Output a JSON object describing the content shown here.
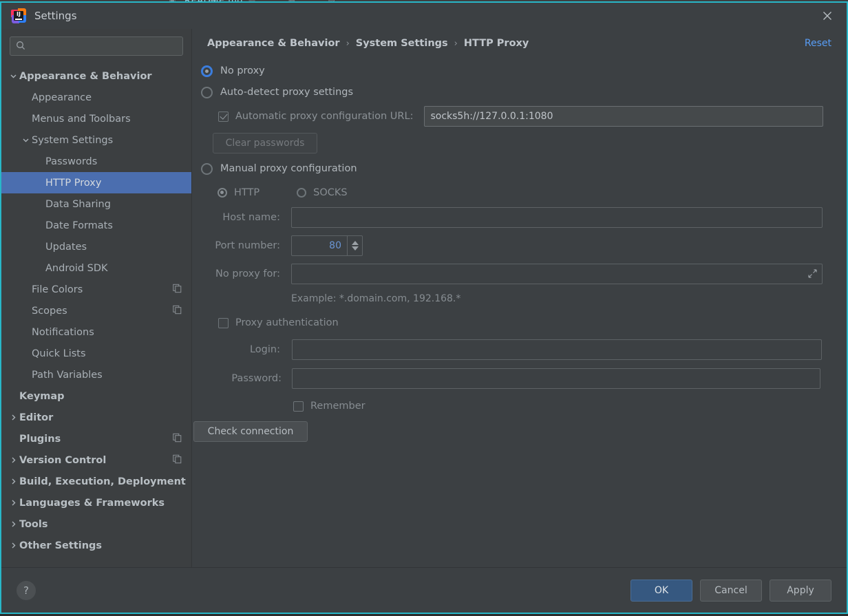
{
  "backdrop": {
    "text": "README.md",
    "icons": "▣ ▤ ▥ ▦ ▧"
  },
  "titlebar": {
    "title": "Settings",
    "logo_text": "IJ",
    "close_icon": "close-icon"
  },
  "sidebar": {
    "search": {
      "value": "",
      "placeholder": "",
      "icon": "search-icon"
    },
    "items": [
      {
        "label": "Appearance & Behavior",
        "indent": 0,
        "bold": true,
        "twisty": "down",
        "selected": false,
        "copy": false
      },
      {
        "label": "Appearance",
        "indent": 1,
        "bold": false,
        "twisty": "none",
        "selected": false,
        "copy": false
      },
      {
        "label": "Menus and Toolbars",
        "indent": 1,
        "bold": false,
        "twisty": "none",
        "selected": false,
        "copy": false
      },
      {
        "label": "System Settings",
        "indent": 1,
        "bold": false,
        "twisty": "down",
        "selected": false,
        "copy": false
      },
      {
        "label": "Passwords",
        "indent": 2,
        "bold": false,
        "twisty": "none",
        "selected": false,
        "copy": false
      },
      {
        "label": "HTTP Proxy",
        "indent": 2,
        "bold": false,
        "twisty": "none",
        "selected": true,
        "copy": false
      },
      {
        "label": "Data Sharing",
        "indent": 2,
        "bold": false,
        "twisty": "none",
        "selected": false,
        "copy": false
      },
      {
        "label": "Date Formats",
        "indent": 2,
        "bold": false,
        "twisty": "none",
        "selected": false,
        "copy": false
      },
      {
        "label": "Updates",
        "indent": 2,
        "bold": false,
        "twisty": "none",
        "selected": false,
        "copy": false
      },
      {
        "label": "Android SDK",
        "indent": 2,
        "bold": false,
        "twisty": "none",
        "selected": false,
        "copy": false
      },
      {
        "label": "File Colors",
        "indent": 1,
        "bold": false,
        "twisty": "none",
        "selected": false,
        "copy": true
      },
      {
        "label": "Scopes",
        "indent": 1,
        "bold": false,
        "twisty": "none",
        "selected": false,
        "copy": true
      },
      {
        "label": "Notifications",
        "indent": 1,
        "bold": false,
        "twisty": "none",
        "selected": false,
        "copy": false
      },
      {
        "label": "Quick Lists",
        "indent": 1,
        "bold": false,
        "twisty": "none",
        "selected": false,
        "copy": false
      },
      {
        "label": "Path Variables",
        "indent": 1,
        "bold": false,
        "twisty": "none",
        "selected": false,
        "copy": false
      },
      {
        "label": "Keymap",
        "indent": 0,
        "bold": true,
        "twisty": "none",
        "selected": false,
        "copy": false
      },
      {
        "label": "Editor",
        "indent": 0,
        "bold": true,
        "twisty": "right",
        "selected": false,
        "copy": false
      },
      {
        "label": "Plugins",
        "indent": 0,
        "bold": true,
        "twisty": "none",
        "selected": false,
        "copy": true
      },
      {
        "label": "Version Control",
        "indent": 0,
        "bold": true,
        "twisty": "right",
        "selected": false,
        "copy": true
      },
      {
        "label": "Build, Execution, Deployment",
        "indent": 0,
        "bold": true,
        "twisty": "right",
        "selected": false,
        "copy": false
      },
      {
        "label": "Languages & Frameworks",
        "indent": 0,
        "bold": true,
        "twisty": "right",
        "selected": false,
        "copy": false
      },
      {
        "label": "Tools",
        "indent": 0,
        "bold": true,
        "twisty": "right",
        "selected": false,
        "copy": false
      },
      {
        "label": "Other Settings",
        "indent": 0,
        "bold": true,
        "twisty": "right",
        "selected": false,
        "copy": false
      }
    ]
  },
  "main": {
    "breadcrumb": {
      "items": [
        "Appearance & Behavior",
        "System Settings",
        "HTTP Proxy"
      ],
      "separator": "›"
    },
    "reset_label": "Reset",
    "proxy_mode": {
      "no_proxy_label": "No proxy",
      "auto_detect_label": "Auto-detect proxy settings",
      "manual_label": "Manual proxy configuration",
      "selected": "no_proxy"
    },
    "auto_section": {
      "pac_checkbox_label": "Automatic proxy configuration URL:",
      "pac_checked": true,
      "pac_url": "socks5h://127.0.0.1:1080",
      "clear_passwords_label": "Clear passwords"
    },
    "manual_section": {
      "http_label": "HTTP",
      "socks_label": "SOCKS",
      "protocol_selected": "HTTP",
      "host_name_label": "Host name:",
      "host_name_value": "",
      "port_number_label": "Port number:",
      "port_number_value": "80",
      "no_proxy_for_label": "No proxy for:",
      "no_proxy_for_value": "",
      "expand_icon": "expand-icon",
      "example_text": "Example: *.domain.com, 192.168.*",
      "proxy_auth_label": "Proxy authentication",
      "proxy_auth_checked": false,
      "login_label": "Login:",
      "login_value": "",
      "password_label": "Password:",
      "password_value": "",
      "remember_label": "Remember",
      "remember_checked": false
    },
    "check_connection_label": "Check connection"
  },
  "footer": {
    "help_label": "?",
    "ok_label": "OK",
    "cancel_label": "Cancel",
    "apply_label": "Apply"
  },
  "colors": {
    "accent_blue": "#4b6eaf",
    "link_blue": "#589df6",
    "primary_button": "#365880",
    "focus_border": "#28b7c8",
    "panel_bg": "#3c4043",
    "sidebar_bg": "#3c3f41"
  }
}
